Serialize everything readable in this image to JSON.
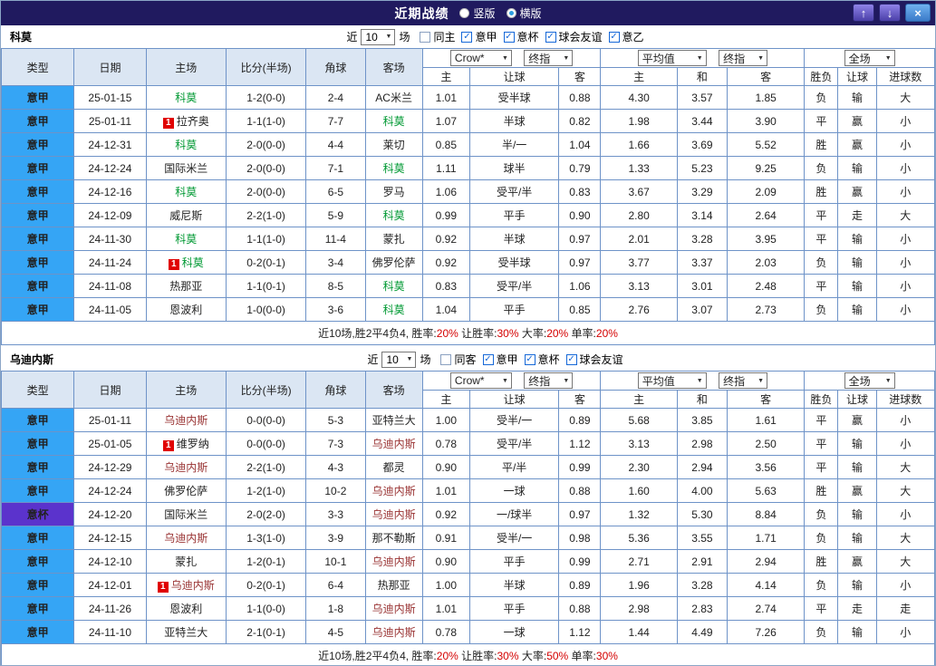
{
  "titlebar": {
    "title": "近期战绩",
    "views": [
      {
        "label": "竖版",
        "selected": false
      },
      {
        "label": "横版",
        "selected": true
      }
    ],
    "up_icon": "↑",
    "down_icon": "↓",
    "close_icon": "×"
  },
  "filter_labels": {
    "recent": "近",
    "unit": "场"
  },
  "headers": {
    "type": "类型",
    "date": "日期",
    "home": "主场",
    "score": "比分(半场)",
    "corners": "角球",
    "away": "客场",
    "bookmaker": "Crow*",
    "final_index": "终指",
    "average": "平均值",
    "fulltime": "全场",
    "sub": [
      "主",
      "让球",
      "客",
      "主",
      "和",
      "客",
      "胜负",
      "让球",
      "进球数"
    ]
  },
  "colors": {
    "league_bg": "#35a5f5",
    "cup_bg": "#5b33cc",
    "score_red": "#d40000",
    "result_red": "#e60000",
    "result_blue": "#2244dd",
    "result_orange": "#ff8800",
    "como_highlight": "#009933",
    "udinese_highlight": "#993333",
    "titlebar_bg": "#201a5f"
  },
  "sections": [
    {
      "team": "科莫",
      "highlight_color": "#009933",
      "filter": {
        "count": "10",
        "checkboxes": [
          {
            "label": "同主",
            "checked": false
          },
          {
            "label": "意甲",
            "checked": true
          },
          {
            "label": "意杯",
            "checked": true
          },
          {
            "label": "球会友谊",
            "checked": true
          },
          {
            "label": "意乙",
            "checked": true
          }
        ]
      },
      "rows": [
        {
          "league": "意甲",
          "date": "25-01-15",
          "home": {
            "name": "科莫",
            "hl": true
          },
          "score": "1-2(0-0)",
          "corners": "2-4",
          "away": {
            "name": "AC米兰"
          },
          "odds": [
            "1.01",
            "受半球",
            "0.88",
            "4.30",
            "3.57",
            "1.85"
          ],
          "results": [
            [
              "负",
              "b"
            ],
            [
              "输",
              "b"
            ],
            [
              "大",
              "r"
            ]
          ]
        },
        {
          "league": "意甲",
          "date": "25-01-11",
          "home": {
            "name": "拉齐奥",
            "badge": "1"
          },
          "score": "1-1(1-0)",
          "corners": "7-7",
          "away": {
            "name": "科莫",
            "hl": true
          },
          "odds": [
            "1.07",
            "半球",
            "0.82",
            "1.98",
            "3.44",
            "3.90"
          ],
          "results": [
            [
              "平",
              "b"
            ],
            [
              "赢",
              "r"
            ],
            [
              "小",
              "b"
            ]
          ]
        },
        {
          "league": "意甲",
          "date": "24-12-31",
          "home": {
            "name": "科莫",
            "hl": true
          },
          "score": "2-0(0-0)",
          "corners": "4-4",
          "away": {
            "name": "莱切"
          },
          "odds": [
            "0.85",
            "半/一",
            "1.04",
            "1.66",
            "3.69",
            "5.52"
          ],
          "results": [
            [
              "胜",
              "r"
            ],
            [
              "赢",
              "r"
            ],
            [
              "小",
              "b"
            ]
          ]
        },
        {
          "league": "意甲",
          "date": "24-12-24",
          "home": {
            "name": "国际米兰"
          },
          "score": "2-0(0-0)",
          "corners": "7-1",
          "away": {
            "name": "科莫",
            "hl": true
          },
          "odds": [
            "1.11",
            "球半",
            "0.79",
            "1.33",
            "5.23",
            "9.25"
          ],
          "results": [
            [
              "负",
              "b"
            ],
            [
              "输",
              "b"
            ],
            [
              "小",
              "b"
            ]
          ]
        },
        {
          "league": "意甲",
          "date": "24-12-16",
          "home": {
            "name": "科莫",
            "hl": true
          },
          "score": "2-0(0-0)",
          "corners": "6-5",
          "away": {
            "name": "罗马"
          },
          "odds": [
            "1.06",
            "受平/半",
            "0.83",
            "3.67",
            "3.29",
            "2.09"
          ],
          "results": [
            [
              "胜",
              "r"
            ],
            [
              "赢",
              "r"
            ],
            [
              "小",
              "b"
            ]
          ]
        },
        {
          "league": "意甲",
          "date": "24-12-09",
          "home": {
            "name": "威尼斯"
          },
          "score": "2-2(1-0)",
          "corners": "5-9",
          "away": {
            "name": "科莫",
            "hl": true
          },
          "odds": [
            "0.99",
            "平手",
            "0.90",
            "2.80",
            "3.14",
            "2.64"
          ],
          "results": [
            [
              "平",
              "b"
            ],
            [
              "走",
              "o"
            ],
            [
              "大",
              "r"
            ]
          ]
        },
        {
          "league": "意甲",
          "date": "24-11-30",
          "home": {
            "name": "科莫",
            "hl": true
          },
          "score": "1-1(1-0)",
          "corners": "11-4",
          "away": {
            "name": "蒙扎"
          },
          "odds": [
            "0.92",
            "半球",
            "0.97",
            "2.01",
            "3.28",
            "3.95"
          ],
          "results": [
            [
              "平",
              "b"
            ],
            [
              "输",
              "b"
            ],
            [
              "小",
              "b"
            ]
          ]
        },
        {
          "league": "意甲",
          "date": "24-11-24",
          "home": {
            "name": "科莫",
            "hl": true,
            "badge": "1"
          },
          "score": "0-2(0-1)",
          "corners": "3-4",
          "away": {
            "name": "佛罗伦萨"
          },
          "odds": [
            "0.92",
            "受半球",
            "0.97",
            "3.77",
            "3.37",
            "2.03"
          ],
          "results": [
            [
              "负",
              "b"
            ],
            [
              "输",
              "b"
            ],
            [
              "小",
              "b"
            ]
          ]
        },
        {
          "league": "意甲",
          "date": "24-11-08",
          "home": {
            "name": "热那亚"
          },
          "score": "1-1(0-1)",
          "corners": "8-5",
          "away": {
            "name": "科莫",
            "hl": true
          },
          "odds": [
            "0.83",
            "受平/半",
            "1.06",
            "3.13",
            "3.01",
            "2.48"
          ],
          "results": [
            [
              "平",
              "b"
            ],
            [
              "输",
              "b"
            ],
            [
              "小",
              "b"
            ]
          ]
        },
        {
          "league": "意甲",
          "date": "24-11-05",
          "home": {
            "name": "恩波利"
          },
          "score": "1-0(0-0)",
          "corners": "3-6",
          "away": {
            "name": "科莫",
            "hl": true
          },
          "odds": [
            "1.04",
            "平手",
            "0.85",
            "2.76",
            "3.07",
            "2.73"
          ],
          "results": [
            [
              "负",
              "b"
            ],
            [
              "输",
              "b"
            ],
            [
              "小",
              "b"
            ]
          ]
        }
      ],
      "summary": [
        {
          "t": "近10场,胜2平4负4, 胜率:",
          "red": false
        },
        {
          "t": "20%",
          "red": true
        },
        {
          "t": " 让胜率:",
          "red": false
        },
        {
          "t": "30%",
          "red": true
        },
        {
          "t": " 大率:",
          "red": false
        },
        {
          "t": "20%",
          "red": true
        },
        {
          "t": " 单率:",
          "red": false
        },
        {
          "t": "20%",
          "red": true
        }
      ]
    },
    {
      "team": "乌迪内斯",
      "highlight_color": "#993333",
      "filter": {
        "count": "10",
        "checkboxes": [
          {
            "label": "同客",
            "checked": false
          },
          {
            "label": "意甲",
            "checked": true
          },
          {
            "label": "意杯",
            "checked": true
          },
          {
            "label": "球会友谊",
            "checked": true
          }
        ]
      },
      "rows": [
        {
          "league": "意甲",
          "date": "25-01-11",
          "home": {
            "name": "乌迪内斯",
            "hl": true
          },
          "score": "0-0(0-0)",
          "corners": "5-3",
          "away": {
            "name": "亚特兰大"
          },
          "odds": [
            "1.00",
            "受半/一",
            "0.89",
            "5.68",
            "3.85",
            "1.61"
          ],
          "results": [
            [
              "平",
              "b"
            ],
            [
              "赢",
              "r"
            ],
            [
              "小",
              "b"
            ]
          ]
        },
        {
          "league": "意甲",
          "date": "25-01-05",
          "home": {
            "name": "维罗纳",
            "badge": "1"
          },
          "score": "0-0(0-0)",
          "corners": "7-3",
          "away": {
            "name": "乌迪内斯",
            "hl": true
          },
          "odds": [
            "0.78",
            "受平/半",
            "1.12",
            "3.13",
            "2.98",
            "2.50"
          ],
          "results": [
            [
              "平",
              "b"
            ],
            [
              "输",
              "b"
            ],
            [
              "小",
              "b"
            ]
          ]
        },
        {
          "league": "意甲",
          "date": "24-12-29",
          "home": {
            "name": "乌迪内斯",
            "hl": true
          },
          "score": "2-2(1-0)",
          "corners": "4-3",
          "away": {
            "name": "都灵"
          },
          "odds": [
            "0.90",
            "平/半",
            "0.99",
            "2.30",
            "2.94",
            "3.56"
          ],
          "results": [
            [
              "平",
              "b"
            ],
            [
              "输",
              "b"
            ],
            [
              "大",
              "r"
            ]
          ]
        },
        {
          "league": "意甲",
          "date": "24-12-24",
          "home": {
            "name": "佛罗伦萨"
          },
          "score": "1-2(1-0)",
          "corners": "10-2",
          "away": {
            "name": "乌迪内斯",
            "hl": true
          },
          "odds": [
            "1.01",
            "一球",
            "0.88",
            "1.60",
            "4.00",
            "5.63"
          ],
          "results": [
            [
              "胜",
              "r"
            ],
            [
              "赢",
              "r"
            ],
            [
              "大",
              "r"
            ]
          ]
        },
        {
          "league": "意杯",
          "cup": true,
          "date": "24-12-20",
          "home": {
            "name": "国际米兰"
          },
          "score": "2-0(2-0)",
          "corners": "3-3",
          "away": {
            "name": "乌迪内斯",
            "hl": true
          },
          "odds": [
            "0.92",
            "一/球半",
            "0.97",
            "1.32",
            "5.30",
            "8.84"
          ],
          "results": [
            [
              "负",
              "b"
            ],
            [
              "输",
              "b"
            ],
            [
              "小",
              "b"
            ]
          ]
        },
        {
          "league": "意甲",
          "date": "24-12-15",
          "home": {
            "name": "乌迪内斯",
            "hl": true
          },
          "score": "1-3(1-0)",
          "corners": "3-9",
          "away": {
            "name": "那不勒斯"
          },
          "odds": [
            "0.91",
            "受半/一",
            "0.98",
            "5.36",
            "3.55",
            "1.71"
          ],
          "results": [
            [
              "负",
              "b"
            ],
            [
              "输",
              "b"
            ],
            [
              "大",
              "r"
            ]
          ]
        },
        {
          "league": "意甲",
          "date": "24-12-10",
          "home": {
            "name": "蒙扎"
          },
          "score": "1-2(0-1)",
          "corners": "10-1",
          "away": {
            "name": "乌迪内斯",
            "hl": true
          },
          "odds": [
            "0.90",
            "平手",
            "0.99",
            "2.71",
            "2.91",
            "2.94"
          ],
          "results": [
            [
              "胜",
              "r"
            ],
            [
              "赢",
              "r"
            ],
            [
              "大",
              "r"
            ]
          ]
        },
        {
          "league": "意甲",
          "date": "24-12-01",
          "home": {
            "name": "乌迪内斯",
            "hl": true,
            "badge": "1"
          },
          "score": "0-2(0-1)",
          "corners": "6-4",
          "away": {
            "name": "热那亚"
          },
          "odds": [
            "1.00",
            "半球",
            "0.89",
            "1.96",
            "3.28",
            "4.14"
          ],
          "results": [
            [
              "负",
              "b"
            ],
            [
              "输",
              "b"
            ],
            [
              "小",
              "b"
            ]
          ]
        },
        {
          "league": "意甲",
          "date": "24-11-26",
          "home": {
            "name": "恩波利"
          },
          "score": "1-1(0-0)",
          "corners": "1-8",
          "away": {
            "name": "乌迪内斯",
            "hl": true
          },
          "odds": [
            "1.01",
            "平手",
            "0.88",
            "2.98",
            "2.83",
            "2.74"
          ],
          "results": [
            [
              "平",
              "b"
            ],
            [
              "走",
              "o"
            ],
            [
              "走",
              "o"
            ]
          ]
        },
        {
          "league": "意甲",
          "date": "24-11-10",
          "home": {
            "name": "亚特兰大"
          },
          "score": "2-1(0-1)",
          "corners": "4-5",
          "away": {
            "name": "乌迪内斯",
            "hl": true
          },
          "odds": [
            "0.78",
            "一球",
            "1.12",
            "1.44",
            "4.49",
            "7.26"
          ],
          "results": [
            [
              "负",
              "b"
            ],
            [
              "输",
              "b"
            ],
            [
              "小",
              "b"
            ]
          ]
        }
      ],
      "summary": [
        {
          "t": "近10场,胜2平4负4, 胜率:",
          "red": false
        },
        {
          "t": "20%",
          "red": true
        },
        {
          "t": " 让胜率:",
          "red": false
        },
        {
          "t": "30%",
          "red": true
        },
        {
          "t": " 大率:",
          "red": false
        },
        {
          "t": "50%",
          "red": true
        },
        {
          "t": " 单率:",
          "red": false
        },
        {
          "t": "30%",
          "red": true
        }
      ]
    }
  ]
}
